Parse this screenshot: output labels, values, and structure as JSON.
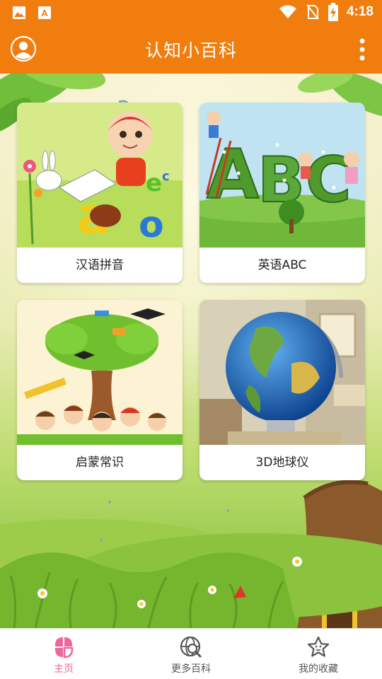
{
  "status_bar": {
    "time": "4:18",
    "left_icons": [
      "image-icon",
      "font-download-icon"
    ],
    "right_icons": [
      "wifi-icon",
      "no-sim-icon",
      "battery-charging-icon"
    ]
  },
  "app_bar": {
    "title": "认知小百科",
    "left_icon": "user-avatar-icon",
    "right_icon": "more-vertical-icon",
    "color": "#f07d0e"
  },
  "categories": [
    {
      "label": "汉语拼音",
      "image": "cartoon-girl-with-letters"
    },
    {
      "label": "英语ABC",
      "image": "abc-topiary-kids"
    },
    {
      "label": "启蒙常识",
      "image": "children-under-knowledge-tree"
    },
    {
      "label": "3D地球仪",
      "image": "world-globe"
    }
  ],
  "bottom_nav": {
    "items": [
      {
        "label": "主页",
        "icon": "home-petals-icon",
        "active": true
      },
      {
        "label": "更多百科",
        "icon": "globe-search-icon",
        "active": false
      },
      {
        "label": "我的收藏",
        "icon": "star-face-icon",
        "active": false
      }
    ],
    "active_color": "#f0659a"
  }
}
